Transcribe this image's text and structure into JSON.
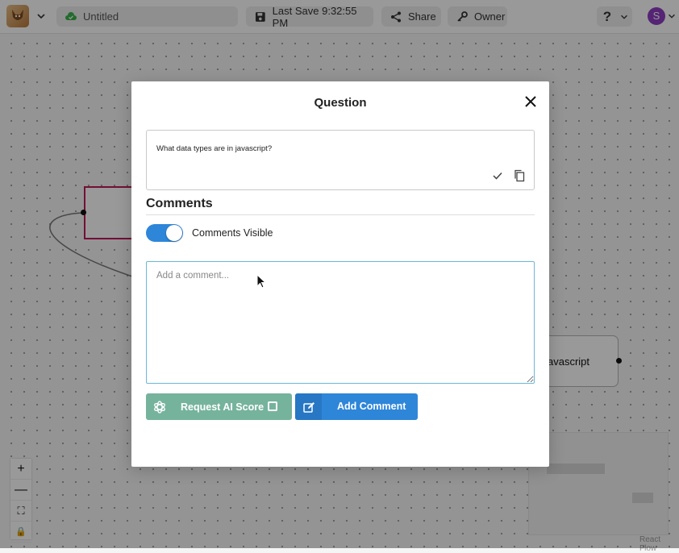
{
  "topbar": {
    "title": "Untitled",
    "last_save": "Last Save 9:32:55 PM",
    "share_label": "Share",
    "owner_label": "Owner",
    "help_label": "?",
    "avatar_initial": "S"
  },
  "canvas": {
    "node_b_label": "avascript",
    "attribution": "React Flow",
    "controls": [
      "+",
      "—",
      "⛶",
      "🔒"
    ]
  },
  "modal": {
    "title": "Question",
    "question_text": "What data types are in javascript?",
    "comments_heading": "Comments",
    "toggle_label": "Comments Visible",
    "toggle_on": true,
    "comment_placeholder": "Add a comment...",
    "comment_value": "",
    "ai_button_label": "Request AI Score",
    "add_comment_label": "Add Comment"
  },
  "colors": {
    "accent_blue": "#2e86d9",
    "ai_green": "#76b39d",
    "node_border": "#c2185b",
    "avatar": "#8e3cc2"
  }
}
